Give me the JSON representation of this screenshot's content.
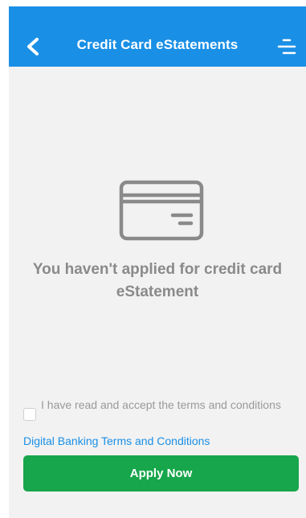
{
  "header": {
    "title": "Credit Card eStatements",
    "back_icon": "chevron-left-icon",
    "menu_icon": "menu-icon"
  },
  "empty_state": {
    "icon": "credit-card-icon",
    "message": "You haven't applied for credit card eStatement"
  },
  "terms": {
    "checkbox_checked": false,
    "label": "I have read and accept the terms and conditions",
    "link_text": "Digital Banking Terms and Conditions"
  },
  "actions": {
    "apply_label": "Apply Now"
  },
  "colors": {
    "header_bg": "#1a8fe6",
    "page_bg": "#f2f2f2",
    "apply_button": "#17a64b",
    "link": "#1a8fe6",
    "muted_text": "#8a8a8a"
  }
}
